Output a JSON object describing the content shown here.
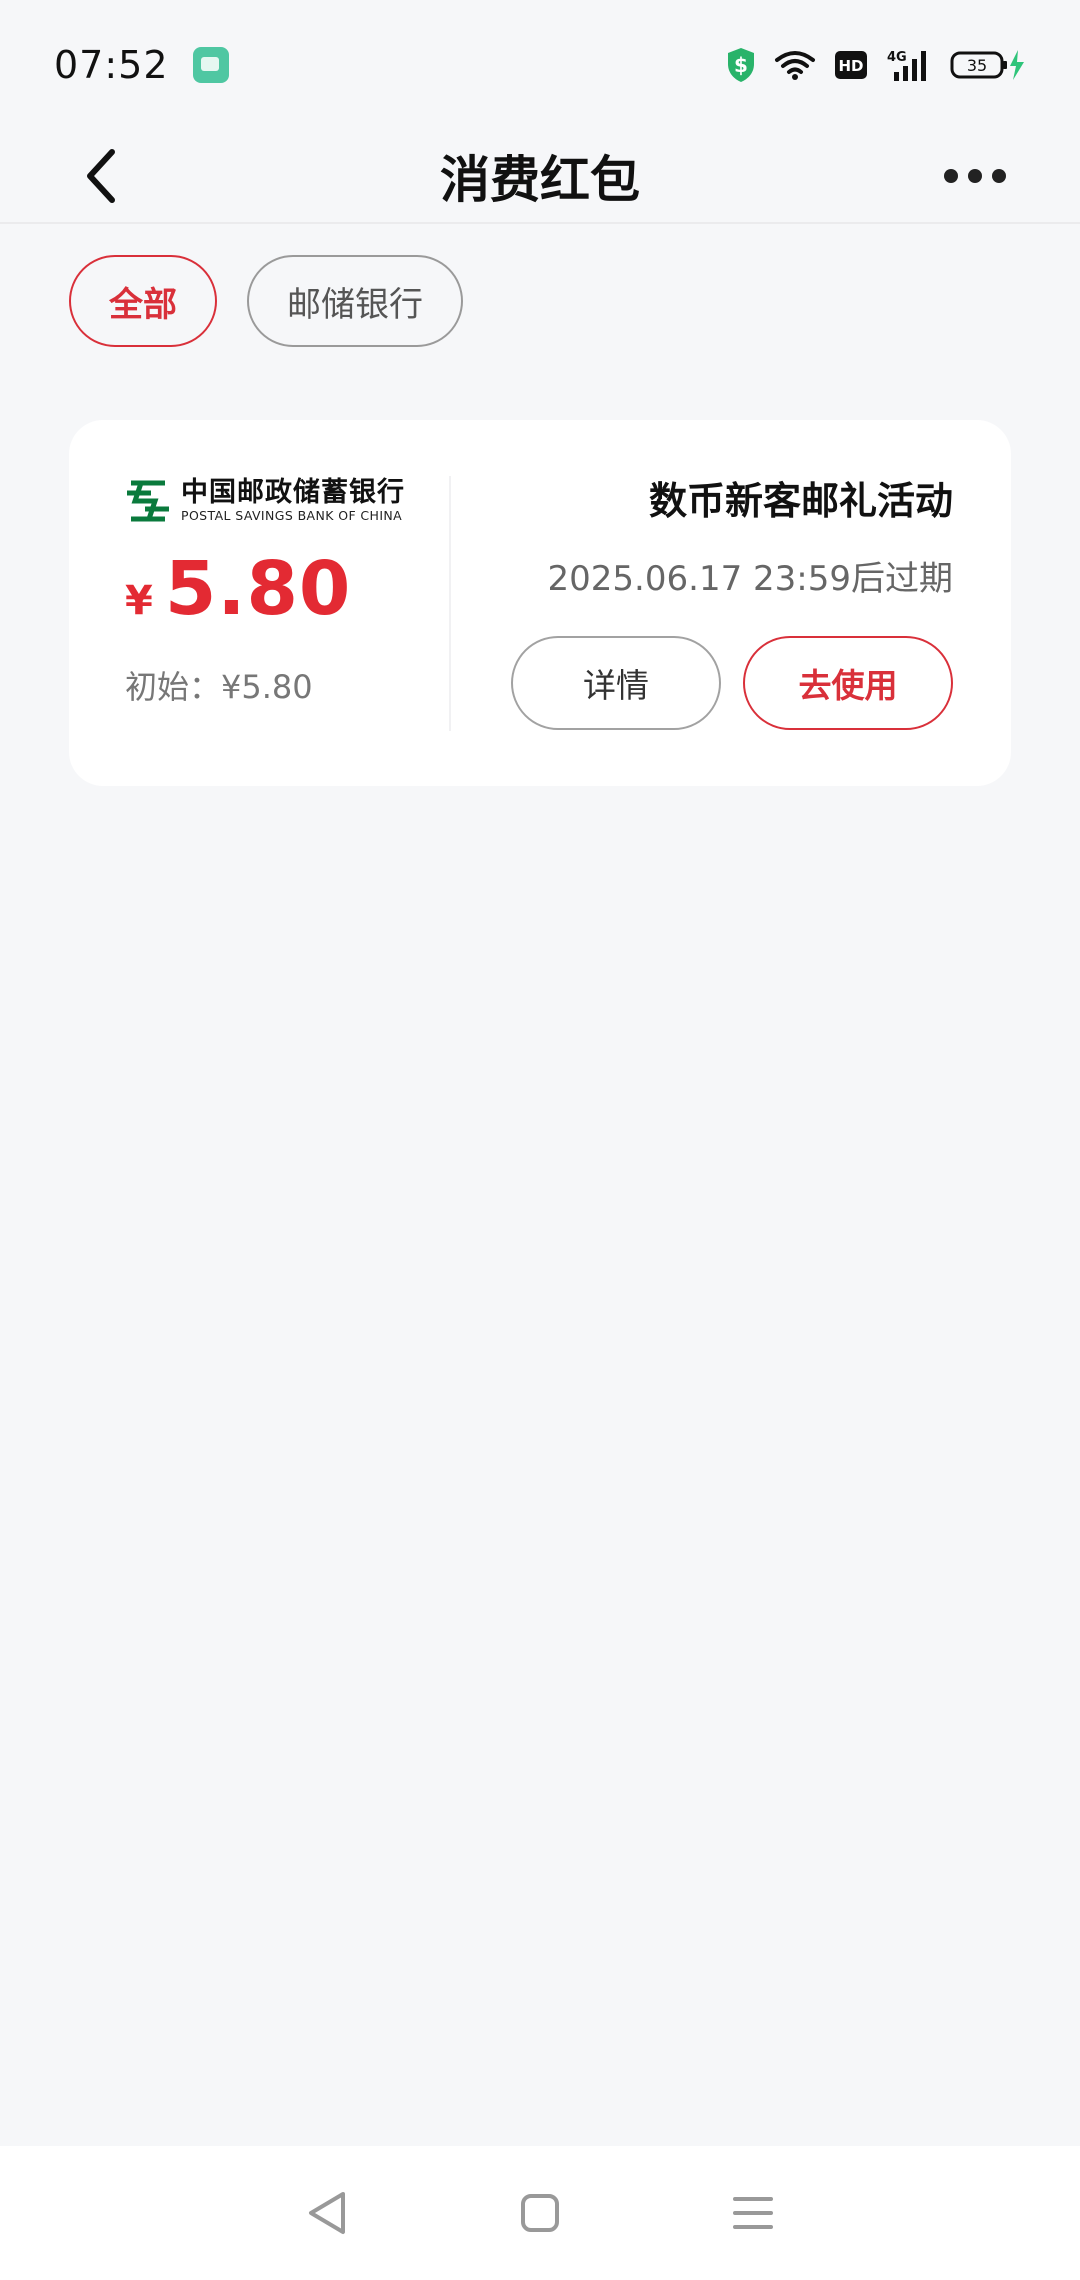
{
  "status_bar": {
    "time": "07:52",
    "network": "4G",
    "hd_label": "HD",
    "battery_level": "35"
  },
  "header": {
    "title": "消费红包"
  },
  "filters": [
    {
      "label": "全部",
      "active": true
    },
    {
      "label": "邮储银行",
      "active": false
    }
  ],
  "coupon": {
    "bank_name_cn": "中国邮政储蓄银行",
    "bank_name_en": "POSTAL SAVINGS BANK OF CHINA",
    "currency_symbol": "¥",
    "amount": "5.80",
    "initial_label": "初始：¥5.80",
    "campaign_title": "数币新客邮礼活动",
    "expiry": "2025.06.17 23:59后过期",
    "details_label": "详情",
    "use_label": "去使用"
  },
  "colors": {
    "accent_red": "#d9303a",
    "amount_red": "#e32a33",
    "background": "#f6f7f9",
    "bank_green": "#0a7a3c"
  },
  "icons": {
    "back": "chevron-left-icon",
    "more": "more-dots-icon",
    "nav_back": "triangle-back-icon",
    "nav_home": "square-home-icon",
    "nav_menu": "hamburger-menu-icon"
  }
}
